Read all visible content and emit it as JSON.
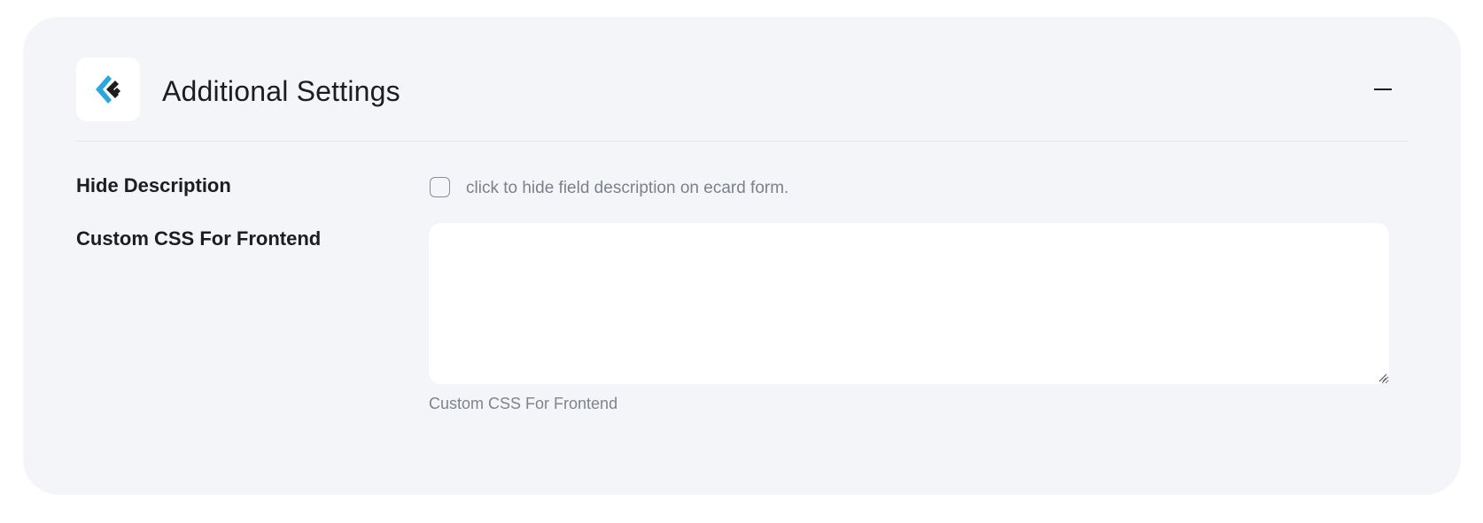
{
  "section": {
    "title": "Additional Settings",
    "logo_icon": "plugin-logo-icon",
    "collapse_icon": "minus-icon"
  },
  "fields": {
    "hide_description": {
      "label": "Hide Description",
      "checked": false,
      "checkbox_text": "click to hide field description on ecard form."
    },
    "custom_css": {
      "label": "Custom CSS For Frontend",
      "value": "",
      "helper_text": "Custom CSS For Frontend"
    }
  },
  "colors": {
    "panel_bg": "#f4f5f9",
    "accent_blue": "#2ba7e0",
    "text_dark": "#1d1d1f",
    "text_muted": "#7d808a"
  }
}
